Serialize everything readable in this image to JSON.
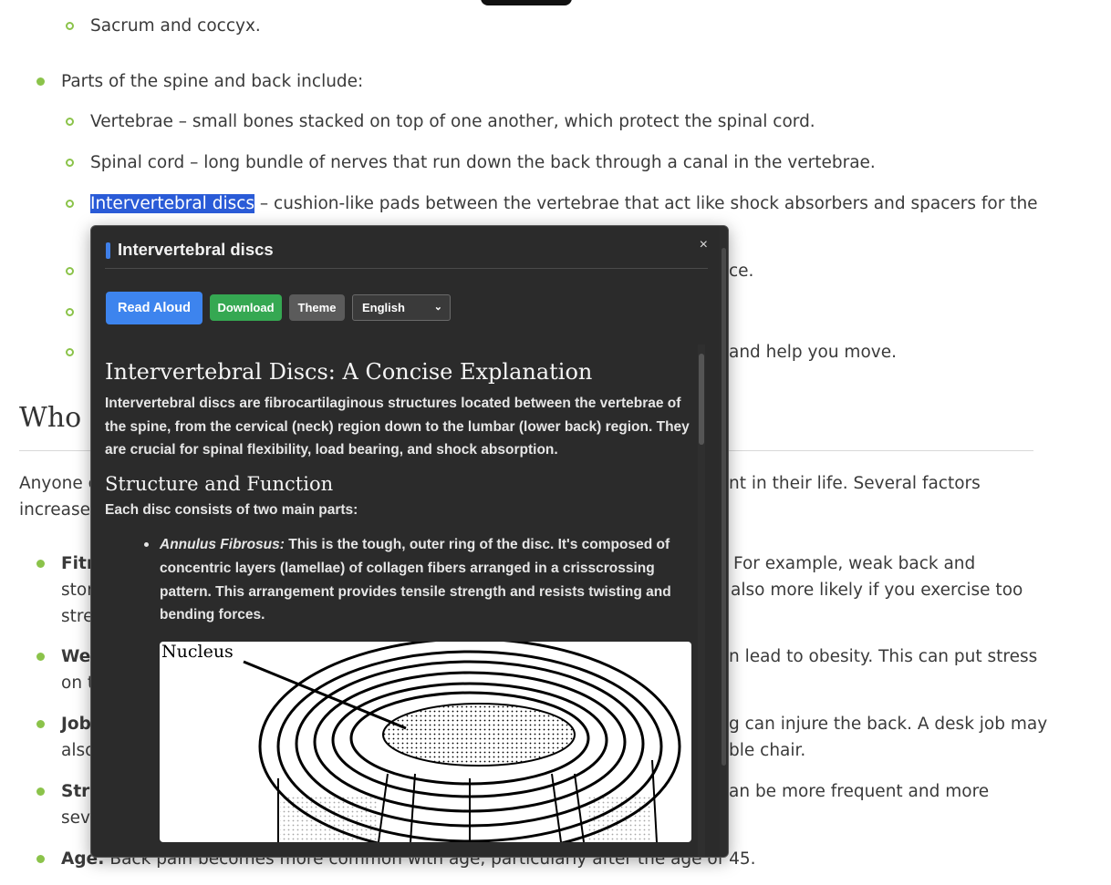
{
  "article": {
    "sub_item_top": "Sacrum and coccyx.",
    "parts_intro": "Parts of the spine and back include:",
    "parts": [
      "Vertebrae – small bones stacked on top of one another, which protect the spinal cord.",
      "Spinal cord – long bundle of nerves that run down the back through a canal in the vertebrae."
    ],
    "disc_term": "Intervertebral discs",
    "disc_rest": " – cushion-like pads between the vertebrae that act like shock absorbers and spacers for the",
    "fragment_ce": "ce.",
    "fragment_move": "and help you move.",
    "heading_partial": "Who C",
    "para_line1_left": "Anyone c",
    "para_line1_right": "nt in their life. Several factors",
    "para_line2_left": "increase",
    "risk_items": [
      {
        "left1": "Fitn",
        "right1": "For example, weak back and",
        "left2": "stor",
        "right2": "also more likely if you exercise too",
        "left3": "stre"
      },
      {
        "left1": "Wei",
        "right1": "n lead to obesity. This can put stress",
        "left2": "on t"
      },
      {
        "left1": "Job-",
        "right1": "g can injure the back. A desk job may",
        "left2": "also",
        "right2": "ble chair."
      },
      {
        "left1": "Stre",
        "right1": "an be more frequent and more",
        "left2": "seve"
      }
    ],
    "age_label": "Age:",
    "age_text": " Back pain becomes more common with age, particularly after the age of 45."
  },
  "popup": {
    "title": "Intervertebral discs",
    "close_glyph": "×",
    "buttons": {
      "read_aloud": "Read Aloud",
      "download": "Download",
      "theme": "Theme"
    },
    "language": {
      "selected": "English",
      "caret": "⌄"
    },
    "content": {
      "h1": "Intervertebral Discs: A Concise Explanation",
      "intro": "Intervertebral discs are fibrocartilaginous structures located between the vertebrae of the spine, from the cervical (neck) region down to the lumbar (lower back) region. They are crucial for spinal flexibility, load bearing, and shock absorption.",
      "h2": "Structure and Function",
      "parts_intro": "Each disc consists of two main parts:",
      "annulus_term": "Annulus Fibrosus:",
      "annulus_text": " This is the tough, outer ring of the disc. It's composed of concentric layers (lamellae) of collagen fibers arranged in a crisscrossing pattern. This arrangement provides tensile strength and resists twisting and bending forces.",
      "figure_label": "Nucleus"
    }
  }
}
